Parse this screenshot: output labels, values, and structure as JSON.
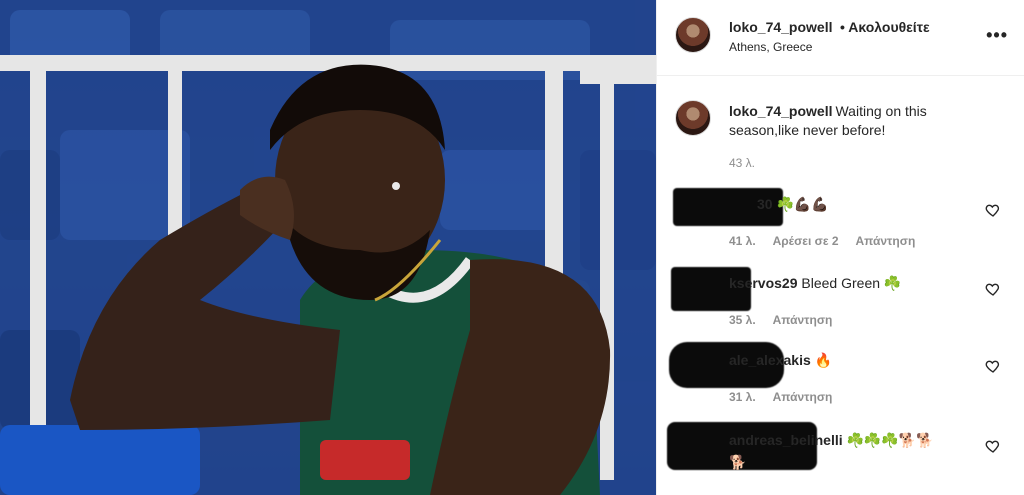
{
  "post": {
    "username": "loko_74_powell",
    "follow_status": "• Ακολουθείτε",
    "location": "Athens, Greece",
    "more_icon": "more-horizontal-icon",
    "caption": "Waiting on this season,like never before!",
    "caption_time": "43 λ."
  },
  "comments": [
    {
      "username": "30",
      "text": "☘️💪🏿💪🏿",
      "time": "41 λ.",
      "likes": "Αρέσει σε 2",
      "reply": "Απάντηση"
    },
    {
      "username": "kservos29",
      "text": "Bleed Green ☘️",
      "time": "35 λ.",
      "likes": "",
      "reply": "Απάντηση"
    },
    {
      "username": "ale_alexakis",
      "text": "🔥",
      "time": "31 λ.",
      "likes": "",
      "reply": "Απάντηση"
    },
    {
      "username": "andreas_belinelli",
      "text": "☘️☘️☘️🐕🐕",
      "text2": "🐕",
      "time": "",
      "likes": "",
      "reply": ""
    }
  ],
  "colors": {
    "accent_green": "#1d8a2e",
    "seat_blue": "#23468c",
    "muted_text": "#8e8e8e"
  }
}
